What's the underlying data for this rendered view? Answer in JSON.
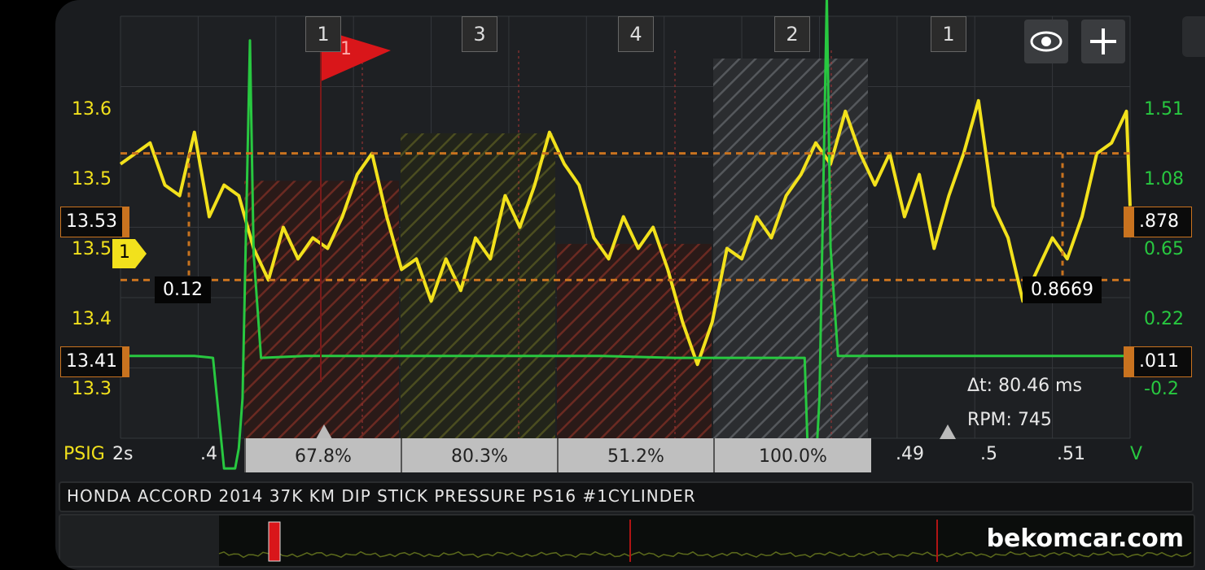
{
  "chart_data": {
    "type": "line",
    "title": "HONDA ACCORD 2014 37K KM DIP STICK PRESSURE PS16 #1CYLINDER",
    "left_axis": {
      "unit": "PSIG",
      "ticks": [
        "13.6",
        "13.5",
        "13.4",
        "13.3"
      ],
      "range": [
        13.26,
        13.66
      ]
    },
    "right_axis": {
      "unit": "V",
      "ticks": [
        "1.51",
        "1.08",
        "0.65",
        "0.22",
        "-0.2"
      ],
      "range": [
        -0.4,
        1.7
      ]
    },
    "x_axis": {
      "prefix": "2s",
      "ticks": [
        ".4",
        ".49",
        ".5",
        ".51"
      ],
      "range": [
        0.385,
        0.5215
      ]
    },
    "series": [
      {
        "name": "PSIG",
        "axis": "left",
        "color": "#f2e11c",
        "x": [
          0.385,
          0.387,
          0.389,
          0.391,
          0.393,
          0.395,
          0.397,
          0.399,
          0.401,
          0.403,
          0.405,
          0.407,
          0.409,
          0.411,
          0.413,
          0.415,
          0.417,
          0.419,
          0.421,
          0.423,
          0.425,
          0.427,
          0.429,
          0.431,
          0.433,
          0.435,
          0.437,
          0.439,
          0.441,
          0.443,
          0.445,
          0.447,
          0.449,
          0.451,
          0.453,
          0.455,
          0.457,
          0.459,
          0.461,
          0.463,
          0.465,
          0.467,
          0.469,
          0.471,
          0.473,
          0.475,
          0.477,
          0.479,
          0.481,
          0.483,
          0.485,
          0.487,
          0.489,
          0.491,
          0.493,
          0.495,
          0.497,
          0.499,
          0.501,
          0.503,
          0.505,
          0.507,
          0.509,
          0.511,
          0.513,
          0.515,
          0.517,
          0.519,
          0.521,
          0.5215
        ],
        "y": [
          13.52,
          13.53,
          13.54,
          13.5,
          13.49,
          13.55,
          13.47,
          13.5,
          13.49,
          13.44,
          13.41,
          13.46,
          13.43,
          13.45,
          13.44,
          13.47,
          13.51,
          13.53,
          13.47,
          13.42,
          13.43,
          13.39,
          13.43,
          13.4,
          13.45,
          13.43,
          13.49,
          13.46,
          13.5,
          13.55,
          13.52,
          13.5,
          13.45,
          13.43,
          13.47,
          13.44,
          13.46,
          13.42,
          13.37,
          13.33,
          13.37,
          13.44,
          13.43,
          13.47,
          13.45,
          13.49,
          13.51,
          13.54,
          13.52,
          13.57,
          13.53,
          13.5,
          13.53,
          13.47,
          13.51,
          13.44,
          13.49,
          13.53,
          13.58,
          13.48,
          13.45,
          13.39,
          13.42,
          13.45,
          13.43,
          13.47,
          13.53,
          13.54,
          13.57,
          13.48
        ]
      },
      {
        "name": "V",
        "axis": "right",
        "color": "#28c840",
        "x": [
          0.385,
          0.39,
          0.395,
          0.3975,
          0.399,
          0.3995,
          0.4005,
          0.401,
          0.4015,
          0.4025,
          0.403,
          0.404,
          0.41,
          0.42,
          0.43,
          0.44,
          0.45,
          0.46,
          0.4775,
          0.478,
          0.479,
          0.4795,
          0.4805,
          0.481,
          0.482,
          0.49,
          0.5,
          0.51,
          0.5215
        ],
        "y": [
          0.01,
          0.01,
          0.01,
          0.0,
          -0.55,
          -0.55,
          -0.55,
          -0.45,
          -0.2,
          1.58,
          0.52,
          0.0,
          0.01,
          0.01,
          0.01,
          0.01,
          0.01,
          0.0,
          0.0,
          -0.55,
          -0.55,
          -0.2,
          1.8,
          0.55,
          0.01,
          0.01,
          0.01,
          0.01,
          0.01
        ]
      }
    ],
    "cursors": {
      "horizontal": [
        {
          "left_label": "13.53",
          "right_label": ".878"
        },
        {
          "left_label": "13.41",
          "right_label": ".011"
        }
      ],
      "delta_labels": [
        "0.12",
        "0.8669"
      ],
      "delta_t": "Δt: 80.46 ms",
      "rpm": "RPM: 745"
    },
    "cylinder_segments": [
      {
        "label": "1"
      },
      {
        "label": "3",
        "percent": "67.8%"
      },
      {
        "label": "4",
        "percent": "80.3%"
      },
      {
        "label": "2",
        "percent": "51.2%"
      },
      {
        "label": "1",
        "percent": "100.0%"
      }
    ],
    "flag_label": "1",
    "marker_label": "1",
    "grid": true,
    "colors": {
      "pressure": "#f2e11c",
      "voltage": "#28c840",
      "cursor": "#c9731f",
      "flag": "#d9161a"
    }
  },
  "watermark": "bekomcar.com"
}
